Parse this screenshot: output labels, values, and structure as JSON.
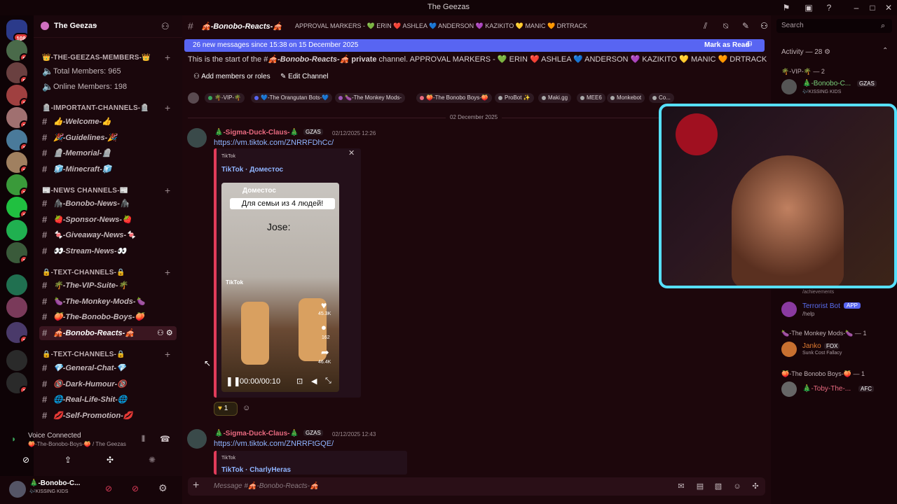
{
  "window": {
    "title": "The Geezas"
  },
  "rail": {
    "home_badge": "108",
    "servers": [
      {
        "badge": "8"
      },
      {
        "badge": "8"
      },
      {
        "badge": "1"
      },
      {
        "badge": "1"
      },
      {
        "badge": "1"
      },
      {
        "badge": "1"
      },
      {
        "badge": "1"
      },
      {
        "badge": "1"
      },
      {
        "badge": ""
      },
      {
        "badge": "1"
      },
      {
        "badge": ""
      },
      {
        "badge": ""
      },
      {
        "badge": "1"
      },
      {
        "badge": ""
      },
      {
        "badge": "1"
      }
    ]
  },
  "server": {
    "name": "The Geezas"
  },
  "sidebar": {
    "cat_members": "👑-THE-GEEZAS-MEMBERS-👑",
    "total_members": "Total Members: 965",
    "online_members": "Online Members: 198",
    "cat_important": "🪦-IMPORTANT-CHANNELS-🪦",
    "important": [
      "👍-Welcome-👍",
      "🎉-Guidelines-🎉",
      "🪦-Memorial-🪦",
      "🧊-Minecraft-🧊"
    ],
    "cat_news": "📰-NEWS CHANNELS-📰",
    "news": [
      "🦍-Bonobo-News-🦍",
      "🍓-Sponsor-News-🍓",
      "🍬-Giveaway-News-🍬",
      "👀-Stream-News-👀"
    ],
    "cat_text1": "🔒-TEXT-CHANNELS-🔒",
    "text1": [
      "🌴-The-VIP-Suite-🌴",
      "🍆-The-Monkey-Mods-🍆",
      "🍑-The-Bonobo-Boys-🍑",
      "🎪-Bonobo-Reacts-🎪"
    ],
    "cat_text2": "🔒-TEXT-CHANNELS-🔒",
    "text2": [
      "💎-General-Chat-💎",
      "🔞-Dark-Humour-🔞",
      "🌐-Real-Life-Shit-🌐",
      "💋-Self-Promotion-💋"
    ]
  },
  "voice": {
    "status": "Voice Connected",
    "channel": "🍑-The-Bonobo-Boys-🍑 / The Geezas"
  },
  "user": {
    "name": "🎄-Bonobo-C...",
    "status": "🎶KISSING KIDS"
  },
  "channel": {
    "name": "🎪-Bonobo-Reacts-🎪",
    "topic": "APPROVAL MARKERS - 💚 ERIN ❤️ ASHLEA 💙 ANDERSON 💜 KAZIKITO 💛 MANIC 🧡 DRTRACK",
    "new_messages": "26 new messages since 15:38 on 15 December 2025",
    "mark_read": "Mark as Read",
    "start_prefix": "This is the start of the #",
    "start_channel": "🎪-Bonobo-Reacts-🎪",
    "start_suffix_bold": "private",
    "start_suffix": "channel. APPROVAL MARKERS - 💚 ERIN ❤️ ASHLEA 💙 ANDERSON 💜 KAZIKITO 💛 MANIC 🧡 DRTRACK",
    "add_members": "Add members or roles",
    "edit_channel": "Edit Channel",
    "roles": [
      "🌴-VIP-🌴",
      "💙-The Orangutan Bots-💙",
      "🍆-The Monkey Mods-",
      "🍑-The Bonobo Boys-🍑",
      "ProBot ✨",
      "Maki.gg",
      "MEE6",
      "Monkebot",
      "Co..."
    ]
  },
  "date_divider": "02 December 2025",
  "messages": [
    {
      "author": "🎄-Sigma-Duck-Claus-🎄",
      "tag": "GZAS",
      "time": "02/12/2025 12:26",
      "link": "https://vm.tiktok.com/ZNRRFDhCc/",
      "embed_provider": "TikTok",
      "embed_title": "TikTok · Доместос",
      "video_account": "Доместос",
      "video_caption": "Для семьи из 4 людей!",
      "video_overlay": "Jose:",
      "video_watermark": "TikTok",
      "likes": "45.3K",
      "comments": "162",
      "shares": "46.4K",
      "time_code": "00:00/00:10",
      "reaction_count": "1"
    },
    {
      "author": "🎄-Sigma-Duck-Claus-🎄",
      "tag": "GZAS",
      "time": "02/12/2025 12:43",
      "link": "https://vm.tiktok.com/ZNRRFtGQE/",
      "embed_provider": "TikTok",
      "embed_title": "TikTok · CharlyHeras"
    }
  ],
  "composer": {
    "placeholder": "Message #🎪-Bonobo-Reacts-🎪"
  },
  "members": {
    "search_placeholder": "Search",
    "activity": "Activity — 28",
    "vip_header": "🌴-VIP-🌴 — 2",
    "vip_name": "🎄-Bonobo-C...",
    "vip_tag": "GZAS",
    "vip_status": "🎶KISSING KIDS",
    "ach_text": "/achievements",
    "bot_name": "Terrorist Bot",
    "bot_badge": "APP",
    "bot_status": "/help",
    "mods_header": "🍆-The Monkey Mods-🍆 — 1",
    "mod_name": "Janko",
    "mod_tag": "FOX",
    "mod_status": "Sunk Cost Fallacy",
    "boys_header": "🍑-The Bonobo Boys-🍑 — 1",
    "boy_name": "🎄-Toby-The-...",
    "boy_tag": "AFC"
  }
}
